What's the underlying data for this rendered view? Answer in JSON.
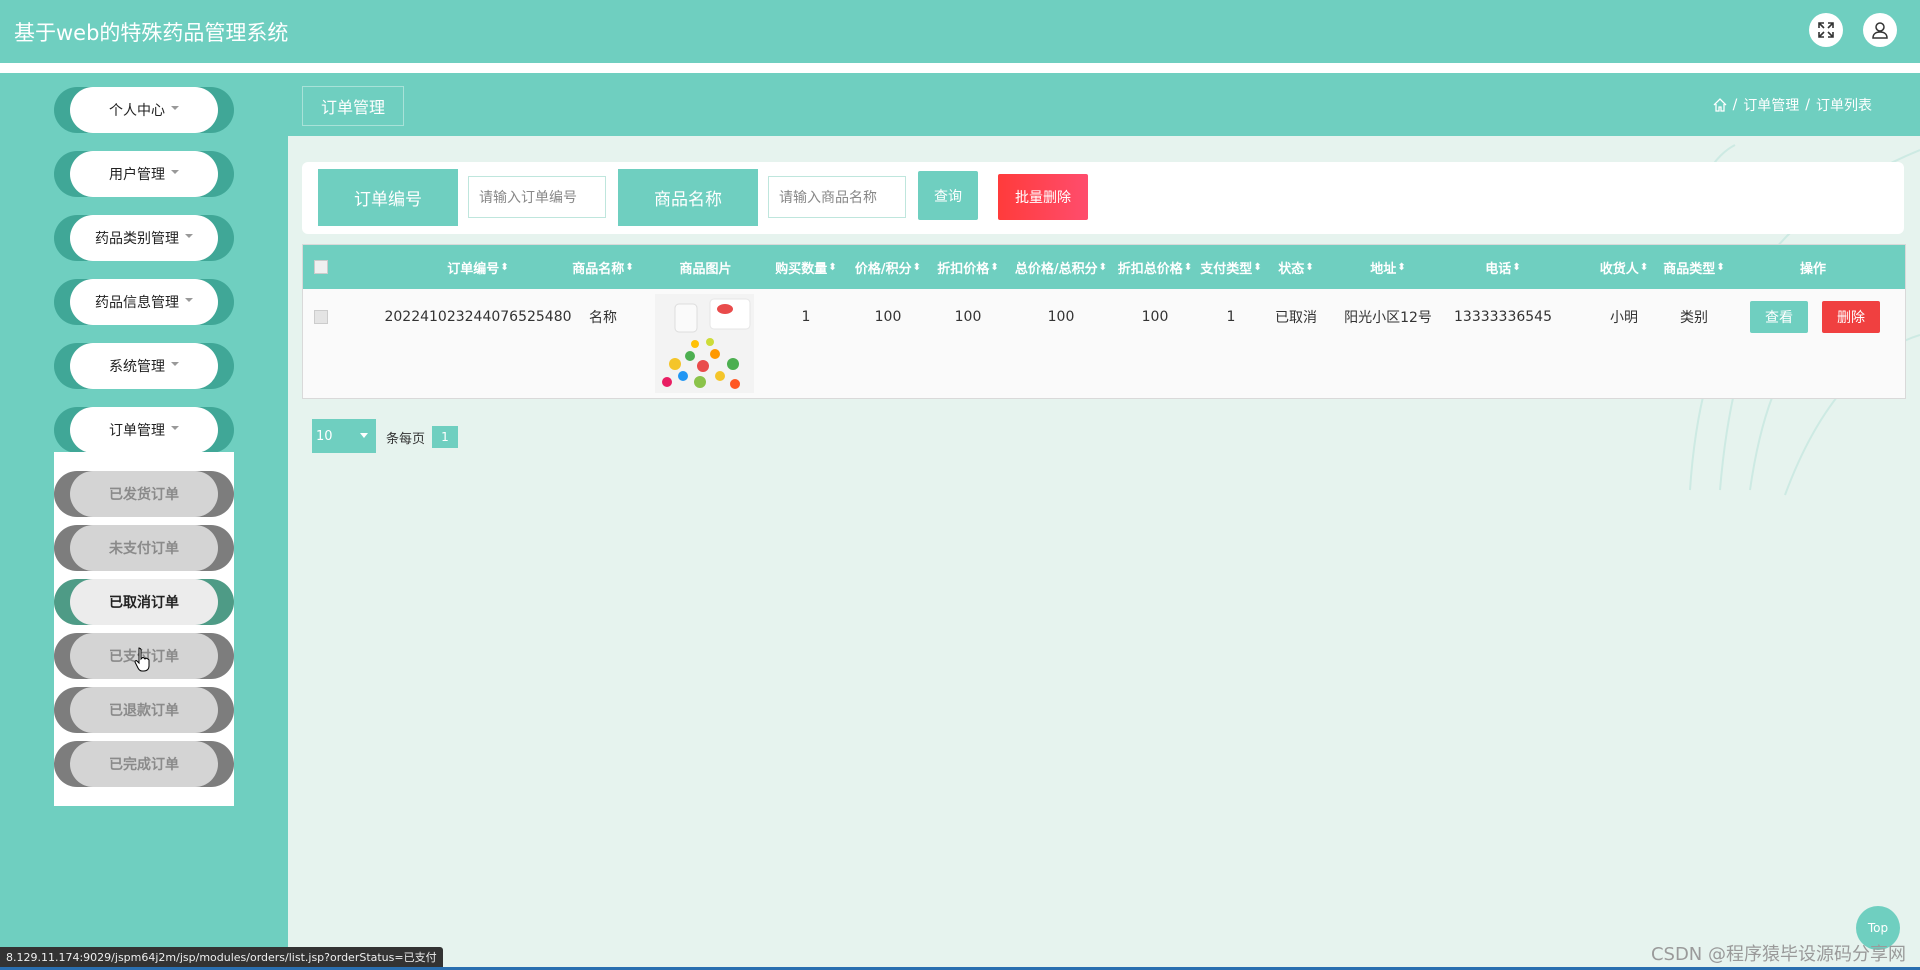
{
  "app": {
    "title": "基于web的特殊药品管理系统"
  },
  "topbar": {
    "icons": [
      "fullscreen-icon",
      "user-icon"
    ]
  },
  "sidebar": {
    "menus": [
      {
        "label": "个人中心"
      },
      {
        "label": "用户管理"
      },
      {
        "label": "药品类别管理"
      },
      {
        "label": "药品信息管理"
      },
      {
        "label": "系统管理"
      },
      {
        "label": "订单管理"
      }
    ],
    "submenus": [
      {
        "label": "已发货订单"
      },
      {
        "label": "未支付订单"
      },
      {
        "label": "已取消订单",
        "active": true
      },
      {
        "label": "已支付订单"
      },
      {
        "label": "已退款订单"
      },
      {
        "label": "已完成订单"
      }
    ]
  },
  "header": {
    "title": "订单管理",
    "breadcrumb": [
      "订单管理",
      "订单列表"
    ],
    "separator": "/"
  },
  "search": {
    "order_no_label": "订单编号",
    "order_no_placeholder": "请输入订单编号",
    "product_label": "商品名称",
    "product_placeholder": "请输入商品名称",
    "query_label": "查询",
    "batch_delete_label": "批量删除"
  },
  "table": {
    "columns": [
      "订单编号",
      "商品名称",
      "商品图片",
      "购买数量",
      "价格/积分",
      "折扣价格",
      "总价格/总积分",
      "折扣总价格",
      "支付类型",
      "状态",
      "地址",
      "电话",
      "收货人",
      "商品类型",
      "操作"
    ],
    "rows": [
      {
        "order_no": "202241023244076525480",
        "product_name": "名称",
        "qty": "1",
        "price": "100",
        "discount_price": "100",
        "total_price": "100",
        "discount_total": "100",
        "pay_type": "1",
        "status": "已取消",
        "address": "阳光小区12号",
        "phone": "13333336545",
        "receiver": "小明",
        "category": "类别",
        "view_label": "查看",
        "delete_label": "删除"
      }
    ]
  },
  "pagination": {
    "page_size": "10",
    "per_page_label": "条每页",
    "current_page": "1"
  },
  "misc": {
    "top_label": "Top",
    "watermark": "CSDN @程序猿毕设源码分享网",
    "status_url": "8.129.11.174:9029/jspm64j2m/jsp/modules/orders/list.jsp?orderStatus=已支付"
  },
  "colors": {
    "primary": "#6fcfc0",
    "danger": "#f04040",
    "background": "#e6f3ee"
  }
}
